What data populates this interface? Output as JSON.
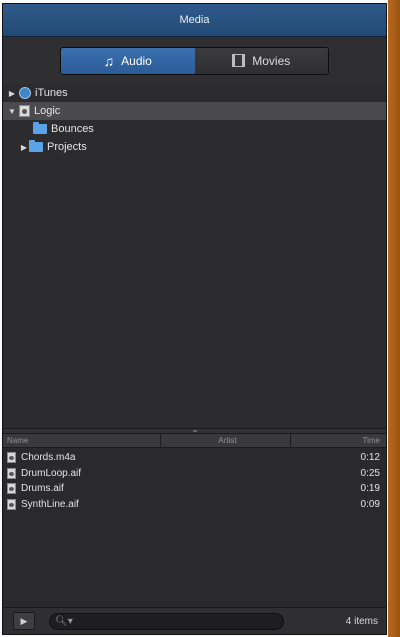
{
  "window": {
    "title": "Media"
  },
  "tabs": [
    {
      "label": "Audio",
      "icon": "music-note-icon",
      "active": true
    },
    {
      "label": "Movies",
      "icon": "film-icon",
      "active": false
    }
  ],
  "tree": {
    "items": [
      {
        "label": "iTunes",
        "icon": "itunes-icon",
        "expanded": false
      },
      {
        "label": "Logic",
        "icon": "logic-document-icon",
        "expanded": true
      },
      {
        "label": "Bounces",
        "icon": "folder-icon"
      },
      {
        "label": "Projects",
        "icon": "folder-icon",
        "expanded": false
      }
    ]
  },
  "columns": {
    "name": "Name",
    "artist": "Artist",
    "time": "Time"
  },
  "files": [
    {
      "name": "Chords.m4a",
      "time": "0:12"
    },
    {
      "name": "DrumLoop.aif",
      "time": "0:25"
    },
    {
      "name": "Drums.aif",
      "time": "0:19"
    },
    {
      "name": "SynthLine.aif",
      "time": "0:09"
    }
  ],
  "footer": {
    "item_count": "4 items",
    "search_placeholder": ""
  },
  "colors": {
    "accent": "#3a6fae",
    "title_bar": "#2f5a8a",
    "folder": "#5ba3e6"
  }
}
